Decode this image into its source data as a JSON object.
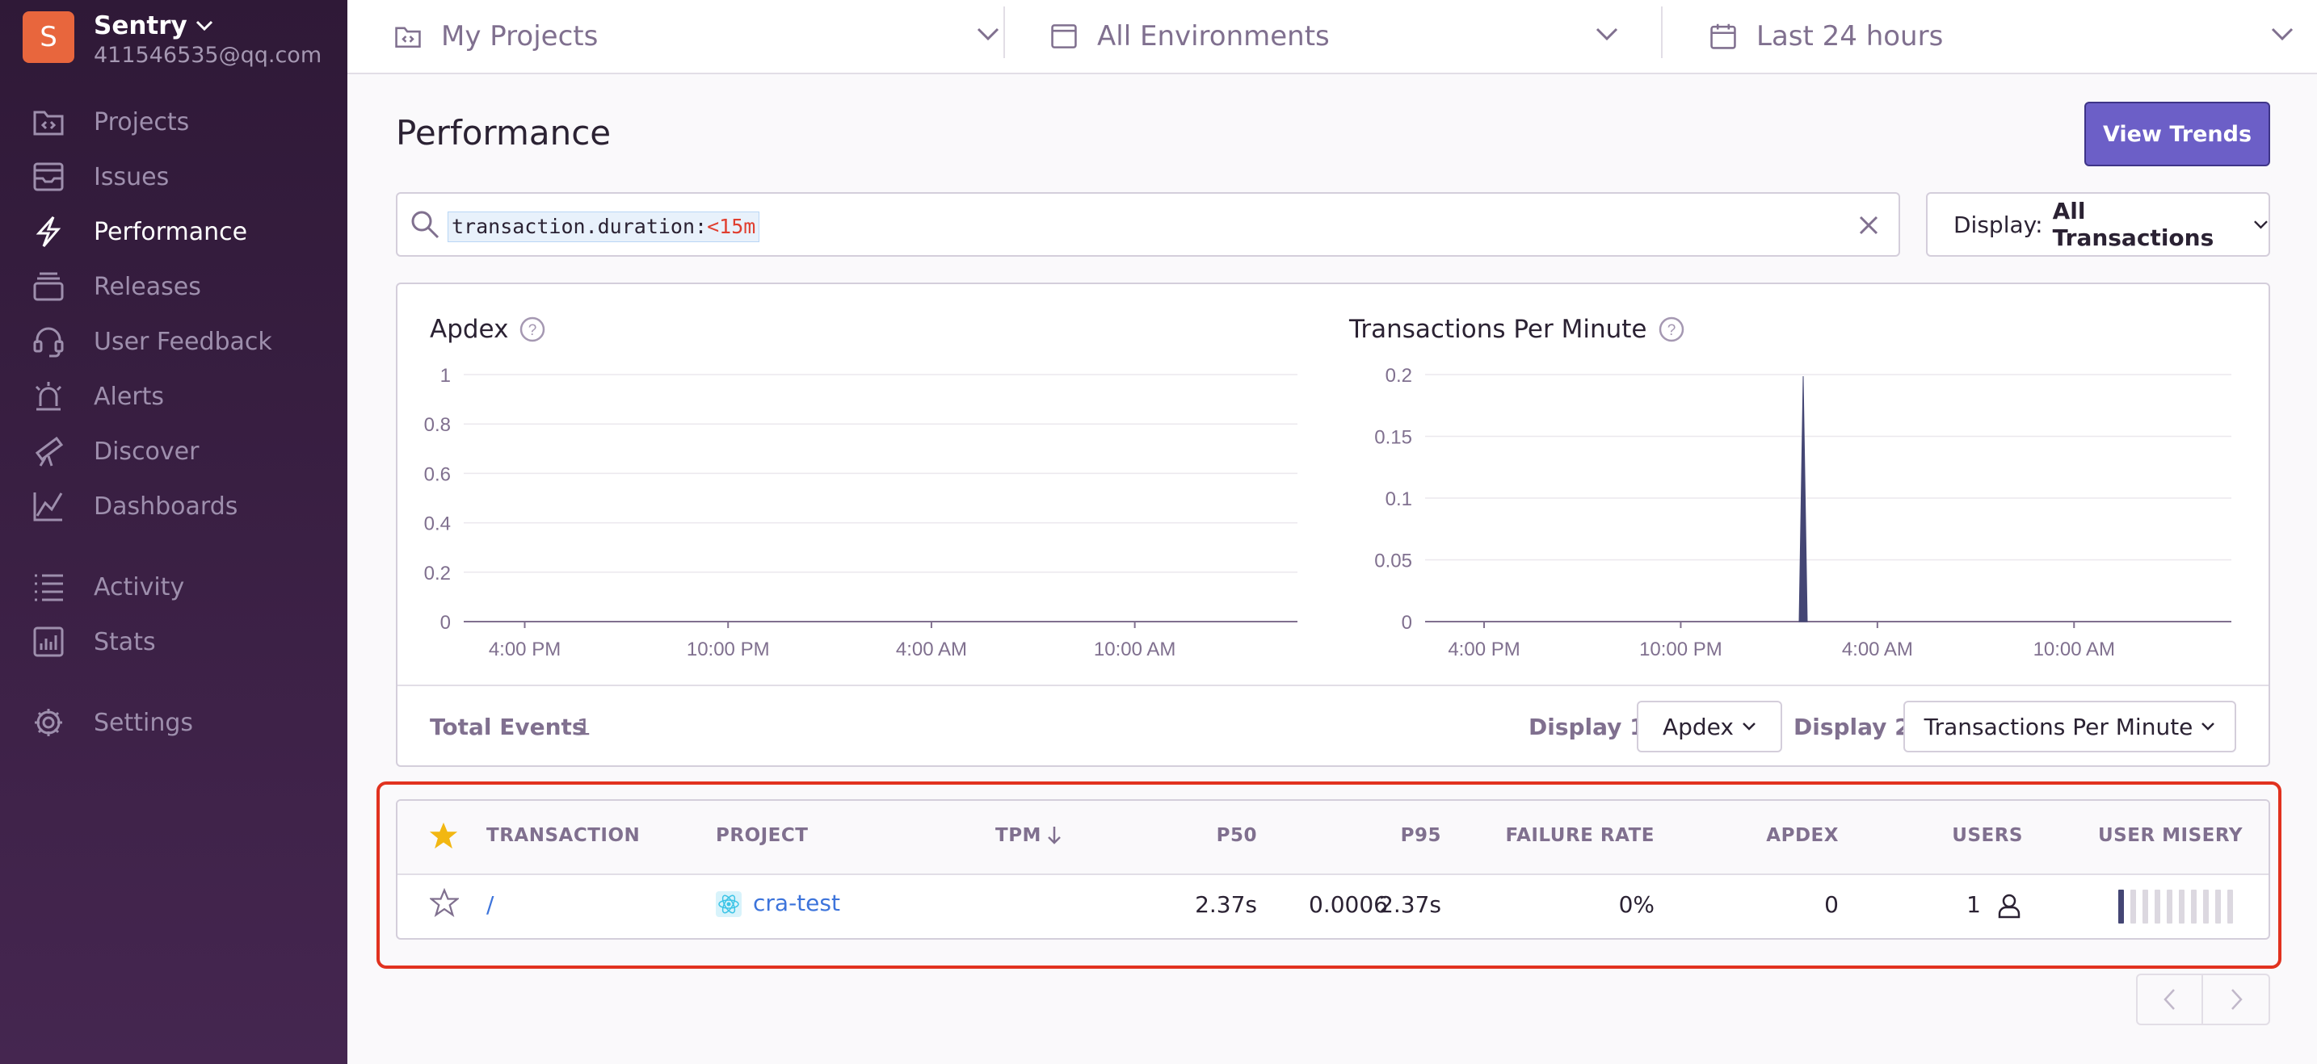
{
  "org": {
    "initial": "S",
    "name": "Sentry",
    "email": "411546535@qq.com"
  },
  "nav": {
    "projects": "Projects",
    "issues": "Issues",
    "performance": "Performance",
    "releases": "Releases",
    "user_feedback": "User Feedback",
    "alerts": "Alerts",
    "discover": "Discover",
    "dashboards": "Dashboards",
    "activity": "Activity",
    "stats": "Stats",
    "settings": "Settings"
  },
  "filters": {
    "projects": "My Projects",
    "environments": "All Environments",
    "period": "Last 24 hours"
  },
  "page": {
    "title": "Performance",
    "view_trends": "View Trends"
  },
  "search": {
    "key": "transaction.duration:",
    "op": "<",
    "value": "15m"
  },
  "display": {
    "label": "Display:",
    "value": "All Transactions"
  },
  "charts": {
    "apdex": {
      "title": "Apdex",
      "yticks": [
        "1",
        "0.8",
        "0.6",
        "0.4",
        "0.2",
        "0"
      ],
      "xticks": [
        "4:00 PM",
        "10:00 PM",
        "4:00 AM",
        "10:00 AM"
      ]
    },
    "tpm": {
      "title": "Transactions Per Minute",
      "yticks": [
        "0.2",
        "0.15",
        "0.1",
        "0.05",
        "0"
      ],
      "xticks": [
        "4:00 PM",
        "10:00 PM",
        "4:00 AM",
        "10:00 AM"
      ]
    }
  },
  "footer": {
    "total_label": "Total Events",
    "total_value": "1",
    "display1_label": "Display 1",
    "display1_value": "Apdex",
    "display2_label": "Display 2",
    "display2_value": "Transactions Per Minute"
  },
  "table": {
    "columns": [
      "TRANSACTION",
      "PROJECT",
      "TPM",
      "P50",
      "P95",
      "FAILURE RATE",
      "APDEX",
      "USERS",
      "USER MISERY"
    ],
    "rows": [
      {
        "transaction": "/",
        "project": "cra-test",
        "tpm": "0.0006",
        "p50": "2.37s",
        "p95": "2.37s",
        "failure_rate": "0%",
        "apdex": "0",
        "users": "1"
      }
    ]
  },
  "colors": {
    "sidebar": "#2f1937",
    "accent": "#6c5fc7",
    "link": "#3d74db",
    "highlight": "#e1321f",
    "chart_line": "#444674"
  }
}
